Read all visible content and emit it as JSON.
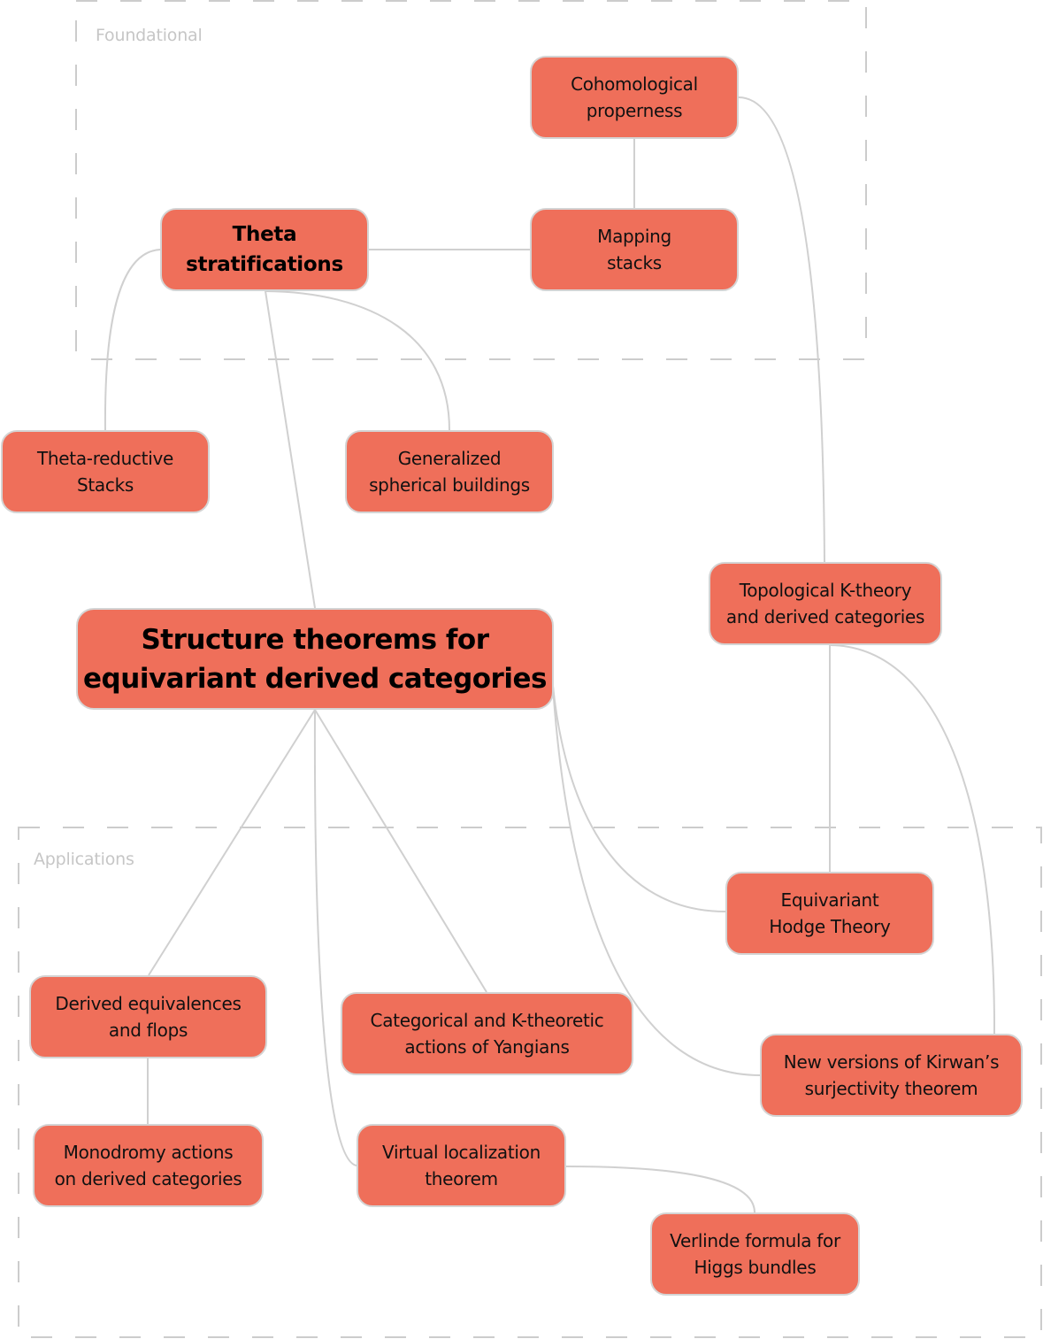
{
  "colors": {
    "node_fill": "#ef6f5a",
    "node_border": "#d4d4d4",
    "edge": "#d0d0d0",
    "group_border": "#cccccc",
    "group_label": "#c6c6c6"
  },
  "groups": [
    {
      "id": "foundational",
      "label": "Foundational"
    },
    {
      "id": "applications",
      "label": "Applications"
    }
  ],
  "nodes": [
    {
      "id": "cohomological",
      "lines": [
        "Cohomological",
        "properness"
      ],
      "group": "foundational"
    },
    {
      "id": "mapping",
      "lines": [
        "Mapping",
        "stacks"
      ],
      "group": "foundational"
    },
    {
      "id": "theta",
      "lines": [
        "Theta",
        "stratifications"
      ],
      "group": "foundational",
      "emphasis": "bold"
    },
    {
      "id": "theta_reductive",
      "lines": [
        "Theta-reductive",
        "Stacks"
      ]
    },
    {
      "id": "generalized",
      "lines": [
        "Generalized",
        "spherical buildings"
      ]
    },
    {
      "id": "topological",
      "lines": [
        "Topological K-theory",
        "and derived categories"
      ]
    },
    {
      "id": "root",
      "lines": [
        "Structure theorems for",
        "equivariant derived categories"
      ],
      "emphasis": "root"
    },
    {
      "id": "hodge",
      "lines": [
        "Equivariant",
        "Hodge Theory"
      ],
      "group": "applications"
    },
    {
      "id": "derived_eq",
      "lines": [
        "Derived equivalences",
        "and flops"
      ],
      "group": "applications"
    },
    {
      "id": "yangians",
      "lines": [
        "Categorical and K-theoretic",
        "actions of Yangians"
      ],
      "group": "applications"
    },
    {
      "id": "kirwan",
      "lines": [
        "New versions of Kirwan’s",
        "surjectivity theorem"
      ],
      "group": "applications"
    },
    {
      "id": "monodromy",
      "lines": [
        "Monodromy actions",
        "on derived categories"
      ],
      "group": "applications"
    },
    {
      "id": "virtual",
      "lines": [
        "Virtual localization",
        "theorem"
      ],
      "group": "applications"
    },
    {
      "id": "verlinde",
      "lines": [
        "Verlinde formula for",
        "Higgs bundles"
      ],
      "group": "applications"
    }
  ],
  "edges": [
    {
      "from": "cohomological",
      "to": "mapping"
    },
    {
      "from": "theta",
      "to": "mapping"
    },
    {
      "from": "cohomological",
      "to": "topological"
    },
    {
      "from": "theta",
      "to": "theta_reductive"
    },
    {
      "from": "theta",
      "to": "generalized"
    },
    {
      "from": "theta",
      "to": "root"
    },
    {
      "from": "topological",
      "to": "hodge"
    },
    {
      "from": "topological",
      "to": "kirwan"
    },
    {
      "from": "root",
      "to": "hodge"
    },
    {
      "from": "root",
      "to": "kirwan"
    },
    {
      "from": "root",
      "to": "derived_eq"
    },
    {
      "from": "root",
      "to": "yangians"
    },
    {
      "from": "root",
      "to": "virtual"
    },
    {
      "from": "derived_eq",
      "to": "monodromy"
    },
    {
      "from": "virtual",
      "to": "verlinde"
    }
  ]
}
